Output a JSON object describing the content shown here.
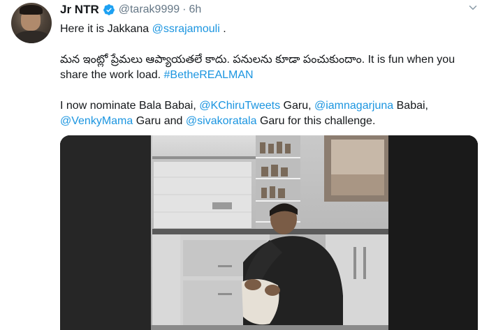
{
  "tweet": {
    "display_name": "Jr NTR",
    "handle": "@tarak9999",
    "separator": "·",
    "time": "6h",
    "line1_text": "Here it is Jakkana ",
    "line1_mention": "@ssrajamouli",
    "line1_end": " .",
    "line2_text": "మన ఇంట్లో ప్రేమలు ఆప్యాయతలే కాదు. పనులను కూడా పంచుకుందాం. It is fun when you share the work load. ",
    "line2_hashtag": "#BetheREALMAN",
    "line3_a": "I now nominate Bala Babai, ",
    "mention_chiru": "@KChiruTweets",
    "line3_b": " Garu, ",
    "mention_nag": "@iamnagarjuna",
    "line3_c": " Babai, ",
    "mention_venky": "@VenkyMama",
    "line3_d": " Garu and ",
    "mention_siva": "@sivakoratala",
    "line3_e": " Garu for this challenge."
  },
  "colors": {
    "link": "#1b95e0",
    "verified": "#1da1f2",
    "meta": "#657786"
  },
  "icons": {
    "verified": "verified-badge-icon",
    "more": "chevron-down-icon"
  }
}
